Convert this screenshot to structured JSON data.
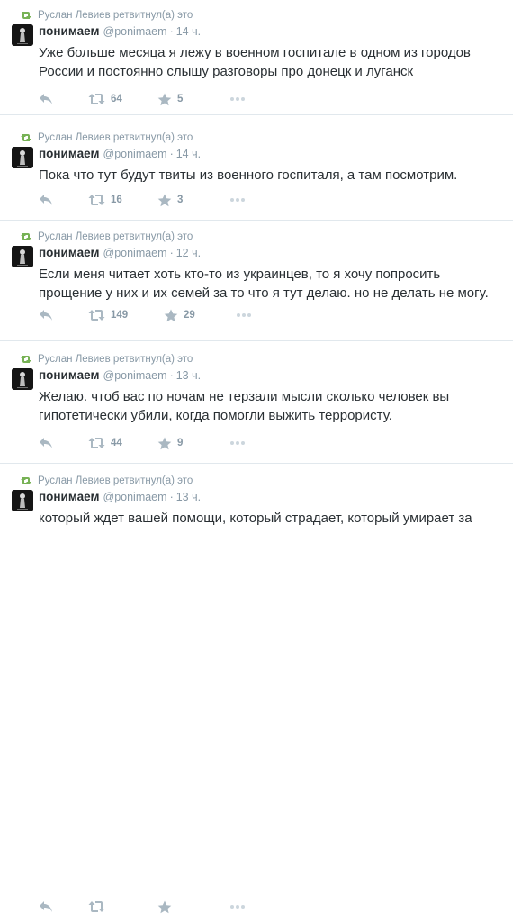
{
  "tweets": [
    {
      "retweet_context": "Руслан Левиев ретвитнул(а) это",
      "name": "понимаем",
      "handle": "@ponimaem",
      "dot": "·",
      "time": "14 ч.",
      "text": "Уже больше месяца я лежу в военном госпитале в одном из городов России и постоянно слышу разговоры про донецк и луганск",
      "retweets": "64",
      "favorites": "5"
    },
    {
      "retweet_context": "Руслан Левиев ретвитнул(а) это",
      "name": "понимаем",
      "handle": "@ponimaem",
      "dot": "·",
      "time": "14 ч.",
      "text": "Пока что тут будут твиты из военного госпиталя, а там посмотрим.",
      "retweets": "16",
      "favorites": "3"
    },
    {
      "retweet_context": "Руслан Левиев ретвитнул(а) это",
      "name": "понимаем",
      "handle": "@ponimaem",
      "dot": "·",
      "time": "12 ч.",
      "text": "Если меня читает хоть кто-то из украинцев, то я хочу попросить прощение у них и их семей за то что я тут делаю. но не делать не могу.",
      "retweets": "149",
      "favorites": "29"
    },
    {
      "retweet_context": "Руслан Левиев ретвитнул(а) это",
      "name": "понимаем",
      "handle": "@ponimaem",
      "dot": "·",
      "time": "13 ч.",
      "text": "Желаю. чтоб вас по ночам не терзали мысли сколько человек вы гипотетически убили, когда помогли выжить террористу.",
      "retweets": "44",
      "favorites": "9"
    },
    {
      "retweet_context": "Руслан Левиев ретвитнул(а) это",
      "name": "понимаем",
      "handle": "@ponimaem",
      "dot": "·",
      "time": "13 ч.",
      "text": "который ждет вашей помощи, который страдает, который умирает за",
      "retweets": "",
      "favorites": ""
    }
  ],
  "colors": {
    "text": "#292f33",
    "muted": "#8899a6",
    "retweet_green": "#77b255",
    "divider": "#e1e8ed"
  }
}
